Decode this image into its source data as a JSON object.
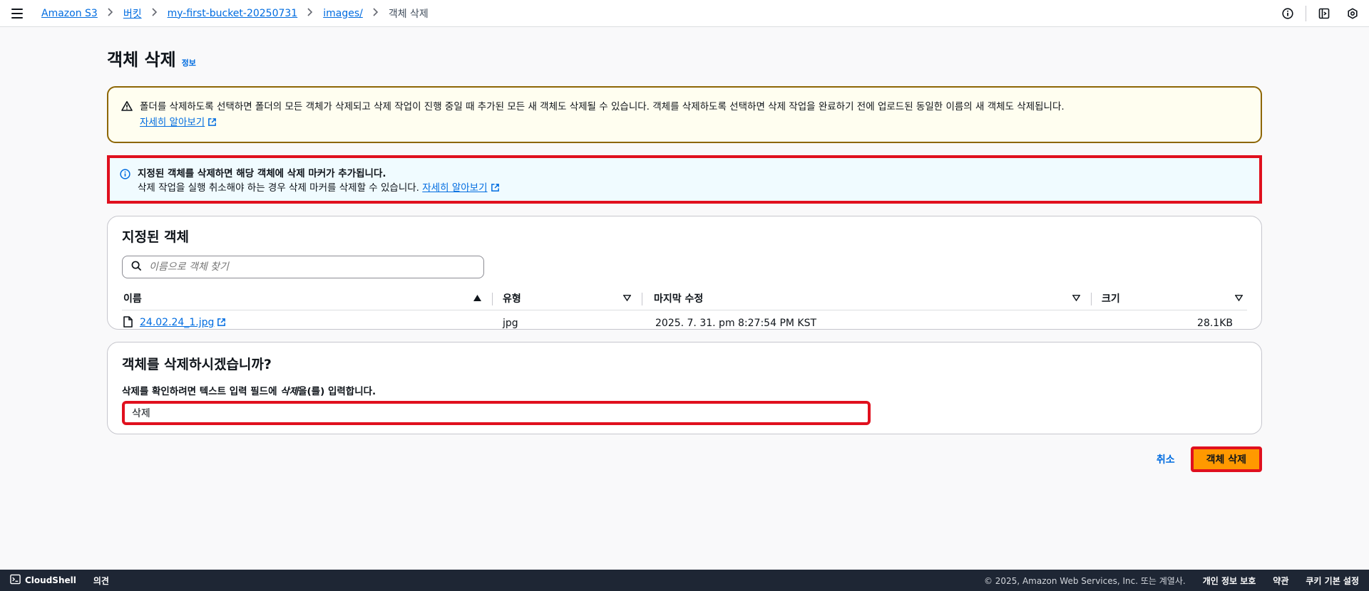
{
  "breadcrumb": {
    "items": [
      "Amazon S3",
      "버킷",
      "my-first-bucket-20250731",
      "images/"
    ],
    "current": "객체 삭제"
  },
  "page": {
    "title": "객체 삭제",
    "info_link": "정보"
  },
  "warning_alert": {
    "text": "폴더를 삭제하도록 선택하면 폴더의 모든 객체가 삭제되고 삭제 작업이 진행 중일 때 추가된 모든 새 객체도 삭제될 수 있습니다. 객체를 삭제하도록 선택하면 삭제 작업을 완료하기 전에 업로드된 동일한 이름의 새 객체도 삭제됩니다.",
    "link": "자세히 알아보기"
  },
  "info_alert": {
    "title": "지정된 객체를 삭제하면 해당 객체에 삭제 마커가 추가됩니다.",
    "body": "삭제 작업을 실행 취소해야 하는 경우 삭제 마커를 삭제할 수 있습니다.",
    "link": "자세히 알아보기"
  },
  "objects_panel": {
    "title": "지정된 객체",
    "search_placeholder": "이름으로 객체 찾기",
    "columns": [
      "이름",
      "유형",
      "마지막 수정",
      "크기"
    ],
    "rows": [
      {
        "name": "24.02.24_1.jpg",
        "type": "jpg",
        "modified": "2025. 7. 31. pm 8:27:54 PM KST",
        "size": "28.1KB"
      }
    ]
  },
  "confirm_panel": {
    "title": "객체를 삭제하시겠습니까?",
    "label_prefix": "삭제를 확인하려면 텍스트 입력 필드에 ",
    "label_keyword": "삭제",
    "label_suffix": "을(를) 입력합니다.",
    "input_value": "삭제"
  },
  "actions": {
    "cancel": "취소",
    "delete": "객체 삭제"
  },
  "footer": {
    "cloudshell": "CloudShell",
    "feedback": "의견",
    "copyright": "© 2025, Amazon Web Services, Inc. 또는 계열사.",
    "privacy": "개인 정보 보호",
    "terms": "약관",
    "cookies": "쿠키 기본 설정"
  },
  "colors": {
    "link": "#006ce0",
    "primary_button": "#ff9900",
    "highlight_border": "#e0101e",
    "footer_bg": "#1e2634"
  }
}
